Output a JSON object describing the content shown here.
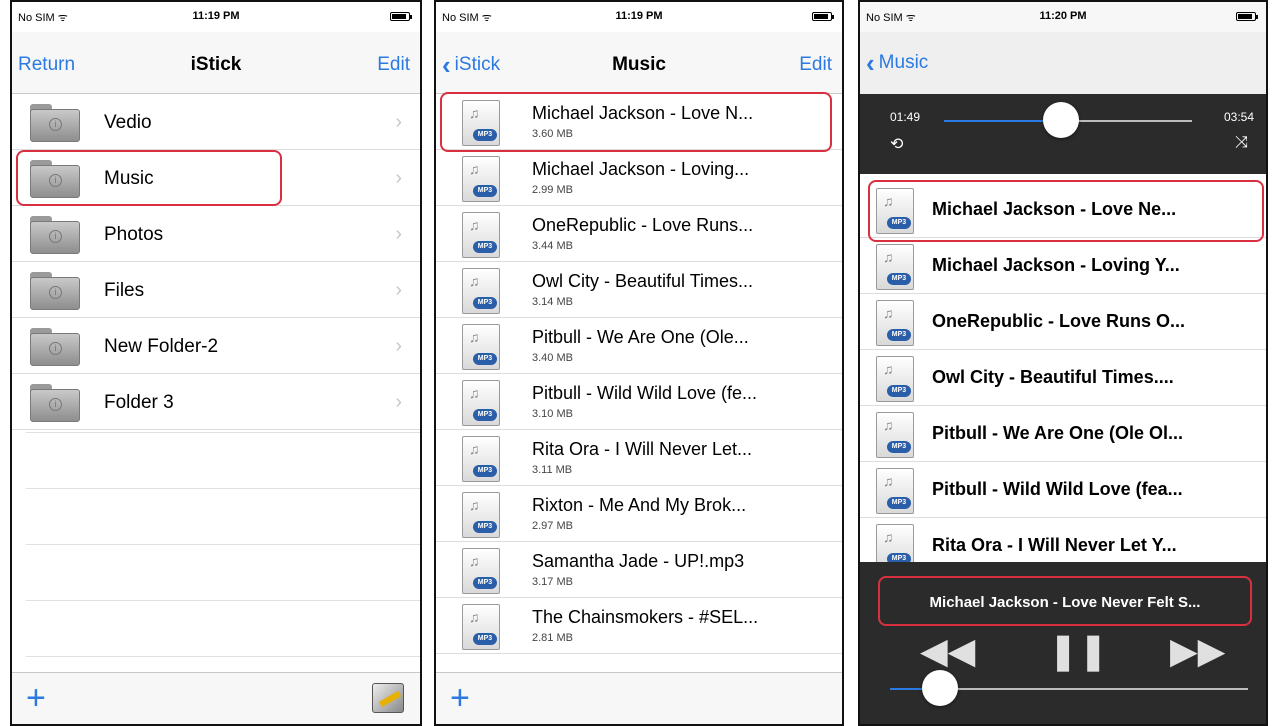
{
  "status": {
    "carrier": "No SIM ᯤ",
    "times": [
      "11:19 PM",
      "11:19 PM",
      "11:20 PM"
    ]
  },
  "screen1": {
    "nav": {
      "left": "Return",
      "title": "iStick",
      "right": "Edit"
    },
    "folders": [
      {
        "label": "Vedio"
      },
      {
        "label": "Music"
      },
      {
        "label": "Photos"
      },
      {
        "label": "Files"
      },
      {
        "label": "New Folder-2"
      },
      {
        "label": "Folder 3"
      }
    ],
    "toolbar": {
      "add": "+"
    }
  },
  "screen2": {
    "nav": {
      "back": "iStick",
      "title": "Music",
      "right": "Edit"
    },
    "songs": [
      {
        "name": "Michael Jackson - Love N...",
        "size": "3.60 MB"
      },
      {
        "name": "Michael Jackson - Loving...",
        "size": "2.99 MB"
      },
      {
        "name": "OneRepublic - Love Runs...",
        "size": "3.44 MB"
      },
      {
        "name": "Owl City - Beautiful Times...",
        "size": "3.14 MB"
      },
      {
        "name": "Pitbull - We Are One (Ole...",
        "size": "3.40 MB"
      },
      {
        "name": "Pitbull - Wild Wild Love (fe...",
        "size": "3.10 MB"
      },
      {
        "name": "Rita Ora - I Will Never Let...",
        "size": "3.11 MB"
      },
      {
        "name": "Rixton - Me And My Brok...",
        "size": "2.97 MB"
      },
      {
        "name": "Samantha Jade - UP!.mp3",
        "size": "3.17 MB"
      },
      {
        "name": "The Chainsmokers - #SEL...",
        "size": "2.81 MB"
      }
    ],
    "toolbar": {
      "add": "+"
    }
  },
  "screen3": {
    "nav": {
      "back": "Music"
    },
    "elapsed": "01:49",
    "duration": "03:54",
    "progress_fraction": 0.47,
    "volume_fraction": 0.14,
    "playlist": [
      "Michael Jackson - Love Ne...",
      "Michael Jackson - Loving Y...",
      "OneRepublic - Love Runs O...",
      "Owl City - Beautiful Times....",
      "Pitbull - We Are One (Ole Ol...",
      "Pitbull - Wild Wild Love (fea...",
      "Rita Ora - I Will Never Let Y..."
    ],
    "now_playing": "Michael Jackson - Love Never Felt S...",
    "controls": {
      "rewind": "◀◀",
      "pause": "❚❚",
      "forward": "▶▶"
    },
    "icons": {
      "repeat": "repeat-icon",
      "shuffle": "shuffle-icon"
    }
  },
  "colors": {
    "accent": "#2a7ae2",
    "highlight": "#d83040",
    "player_bg": "#2b2b2b"
  }
}
